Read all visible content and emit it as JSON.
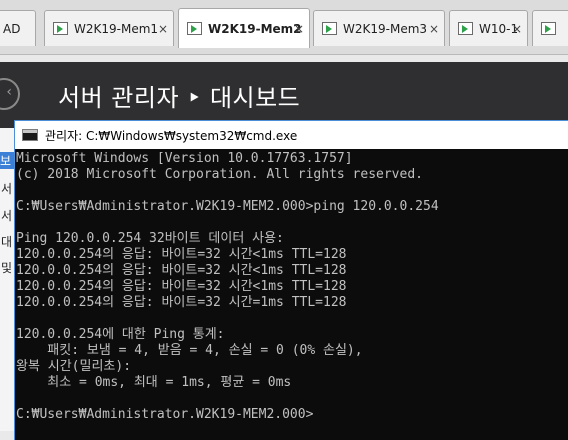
{
  "tabs": [
    {
      "label": "AD",
      "active": false
    },
    {
      "label": "W2K19-Mem1",
      "active": false
    },
    {
      "label": "W2K19-Mem2",
      "active": true
    },
    {
      "label": "W2K19-Mem3",
      "active": false
    },
    {
      "label": "W10-1",
      "active": false
    },
    {
      "label": "",
      "active": false
    }
  ],
  "tab_close_glyph": "×",
  "server_manager": {
    "title": "서버 관리자 ‣ 대시보드",
    "sidebar_items": [
      "보",
      "서",
      "서",
      "대",
      "및"
    ]
  },
  "cmd": {
    "title": "관리자: C:₩Windows₩system32₩cmd.exe",
    "lines": [
      "Microsoft Windows [Version 10.0.17763.1757]",
      "(c) 2018 Microsoft Corporation. All rights reserved.",
      "",
      "C:₩Users₩Administrator.W2K19-MEM2.000>ping 120.0.0.254",
      "",
      "Ping 120.0.0.254 32바이트 데이터 사용:",
      "120.0.0.254의 응답: 바이트=32 시간<1ms TTL=128",
      "120.0.0.254의 응답: 바이트=32 시간<1ms TTL=128",
      "120.0.0.254의 응답: 바이트=32 시간<1ms TTL=128",
      "120.0.0.254의 응답: 바이트=32 시간=1ms TTL=128",
      "",
      "120.0.0.254에 대한 Ping 통계:",
      "    패킷: 보냄 = 4, 받음 = 4, 손실 = 0 (0% 손실),",
      "왕복 시간(밀리초):",
      "    최소 = 0ms, 최대 = 1ms, 평균 = 0ms",
      "",
      "C:₩Users₩Administrator.W2K19-MEM2.000>"
    ]
  },
  "colors": {
    "console_bg": "#0c0c0c",
    "console_text": "#c0c0c0",
    "server_manager_header": "#2f2f31",
    "window_border": "#4b8fd6",
    "vm_running_green": "#2ea04a"
  }
}
